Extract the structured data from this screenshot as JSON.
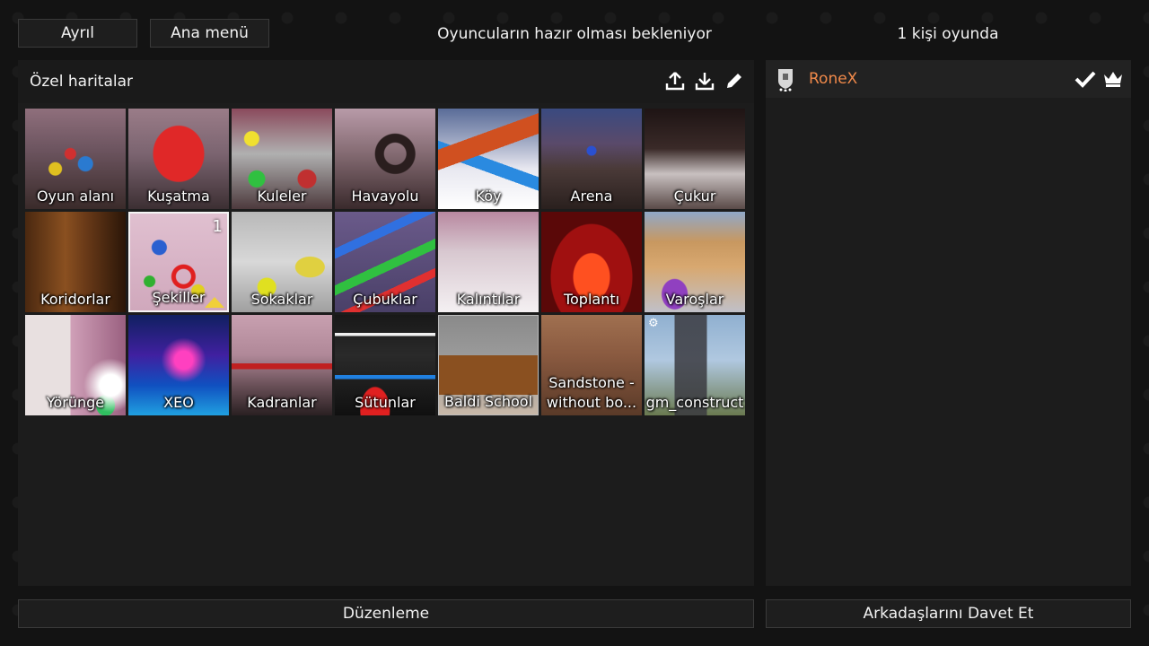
{
  "top": {
    "leave_label": "Ayrıl",
    "main_menu_label": "Ana menü",
    "status_text": "Oyuncuların hazır olması bekleniyor",
    "players_in_game": "1 kişi oyunda"
  },
  "maps_panel": {
    "title": "Özel haritalar",
    "icons": [
      "upload-icon",
      "download-icon",
      "edit-icon"
    ],
    "tiles": [
      {
        "label": "Oyun alanı"
      },
      {
        "label": "Kuşatma"
      },
      {
        "label": "Kuleler"
      },
      {
        "label": "Havayolu"
      },
      {
        "label": "Köy"
      },
      {
        "label": "Arena"
      },
      {
        "label": "Çukur"
      },
      {
        "label": "Koridorlar"
      },
      {
        "label": "Şekiller",
        "badge": "1"
      },
      {
        "label": "Sokaklar"
      },
      {
        "label": "Çubuklar"
      },
      {
        "label": "Kalıntılar"
      },
      {
        "label": "Toplantı"
      },
      {
        "label": "Varoşlar"
      },
      {
        "label": "Yörünge"
      },
      {
        "label": "XEO"
      },
      {
        "label": "Kadranlar"
      },
      {
        "label": "Sütunlar"
      },
      {
        "label": "Baldi School"
      },
      {
        "label": "Sandstone - without bo..."
      },
      {
        "label": "gm_construct"
      }
    ]
  },
  "players_panel": {
    "player_name": "RoneX",
    "player_color": "#f0894a",
    "icons": [
      "avatar-icon",
      "ready-check-icon",
      "host-crown-icon"
    ]
  },
  "bottom": {
    "edit_label": "Düzenleme",
    "invite_label": "Arkadaşlarını Davet Et"
  }
}
